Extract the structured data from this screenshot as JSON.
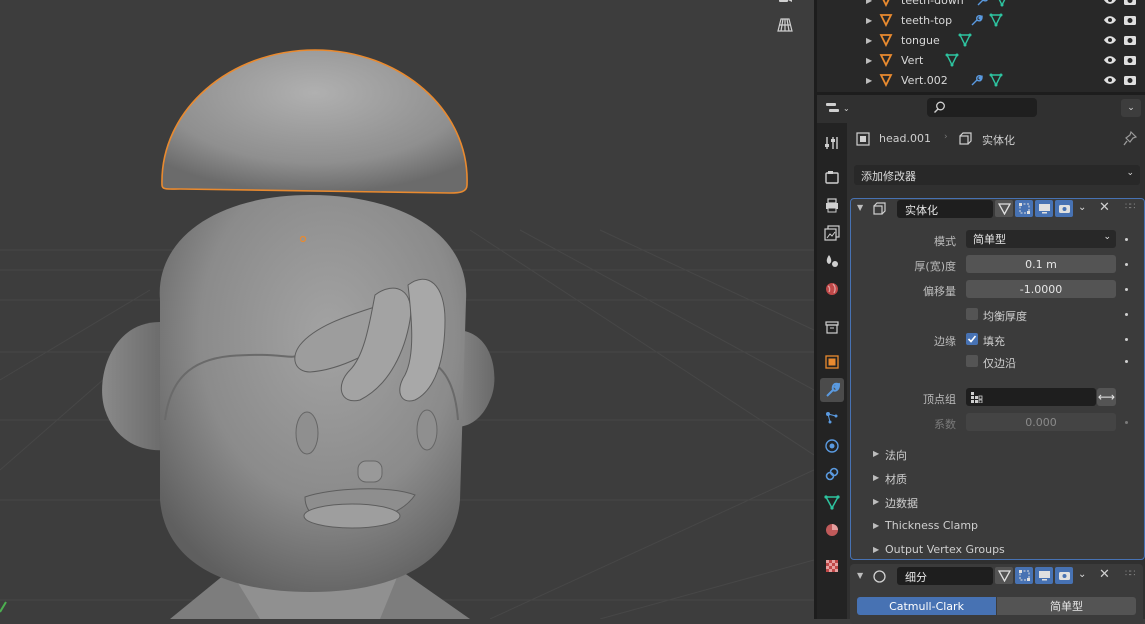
{
  "viewport": {
    "tools": [
      {
        "icon": "camera-view-icon"
      },
      {
        "icon": "perspective-grid-icon"
      }
    ]
  },
  "outliner": {
    "rows": [
      {
        "name": "teeth-down",
        "has_modifier": true
      },
      {
        "name": "teeth-top",
        "has_modifier": true
      },
      {
        "name": "tongue",
        "has_modifier": false
      },
      {
        "name": "Vert",
        "has_modifier": false
      },
      {
        "name": "Vert.002",
        "has_modifier": true
      }
    ]
  },
  "properties": {
    "search_placeholder": "",
    "breadcrumb": {
      "object": "head.001",
      "modifier": "实体化"
    },
    "add_modifier": "添加修改器",
    "solidify": {
      "name": "实体化",
      "mode_label": "模式",
      "mode_value": "简单型",
      "thickness_label": "厚(宽)度",
      "thickness_value": "0.1 m",
      "offset_label": "偏移量",
      "offset_value": "-1.0000",
      "even_label": "均衡厚度",
      "rim_label": "边缘",
      "fill_label": "填充",
      "rim_only_label": "仅边沿",
      "vgroup_label": "顶点组",
      "vgroup_value": "",
      "factor_label": "系数",
      "factor_value": "0.000",
      "subpanels": [
        "法向",
        "材质",
        "边数据",
        "Thickness Clamp",
        "Output Vertex Groups"
      ]
    },
    "subsurf": {
      "name": "细分",
      "options": [
        "Catmull-Clark",
        "简单型"
      ],
      "active_option": "Catmull-Clark"
    }
  },
  "colors": {
    "selection": "#e98a2f",
    "accent": "#4772b3",
    "mesh_green": "#2ec4a0",
    "modifier_blue": "#5a9ae0"
  }
}
